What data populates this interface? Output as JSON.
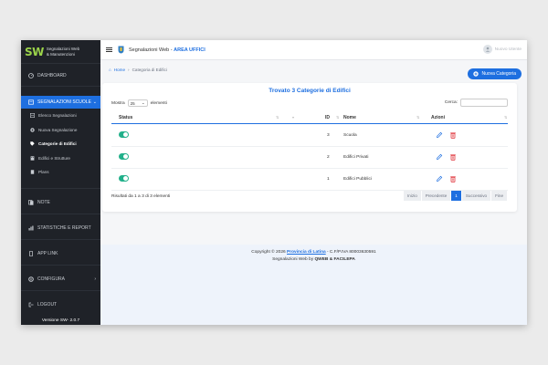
{
  "colors": {
    "accent": "#1e6fe0",
    "sidebar": "#1f2228",
    "toggle_on": "#21b08a",
    "delete": "#e0343b",
    "brand_green": "#9bd34a"
  },
  "sidebar": {
    "brand_short": "SW",
    "brand_line1": "Segnalazioni Web",
    "brand_line2": "& Manutenzioni",
    "dashboard": "DASHBOARD",
    "segnalazioni": "SEGNALAZIONI SCUOLE",
    "sub": {
      "elenco": "Elenco Segnalazioni",
      "nuova": "Nuova Segnalazione",
      "categorie": "Categorie di Edifici",
      "edifici": "Edifici e Strutture",
      "plans": "Plans"
    },
    "note": "NOTE",
    "statistiche": "STATISTICHE E REPORT",
    "app_link": "APP LINK",
    "configura": "CONFIGURA",
    "logout": "LOGOUT",
    "version": "Versione SW- 2.0.7"
  },
  "topbar": {
    "title_prefix": "Segnalazioni Web - ",
    "title_area": "AREA UFFICI",
    "user_name": "Nuovo Utente"
  },
  "breadcrumb": {
    "home": "Home",
    "current": "Categoria di Edifici"
  },
  "new_button": "Nuova Categoria",
  "card": {
    "title": "Trovato 3 Categorie di Edifici",
    "show_label": "Mostra",
    "show_value": "25",
    "show_suffix": "elementi",
    "search_label": "Cerca:",
    "columns": {
      "status": "Status",
      "id": "ID",
      "nome": "Nome",
      "azioni": "Azioni"
    },
    "rows": [
      {
        "status_on": true,
        "id": "3",
        "nome": "Scuola"
      },
      {
        "status_on": true,
        "id": "2",
        "nome": "Edifici Privati"
      },
      {
        "status_on": true,
        "id": "1",
        "nome": "Edifici Pubblici"
      }
    ],
    "info": "Risultati da 1 a 3 di 3 elementi",
    "pager": {
      "first": "Inizio",
      "prev": "Precedente",
      "current": "1",
      "next": "Successivo",
      "last": "Fine"
    }
  },
  "footer": {
    "line1_prefix": "Copyright © 2026 ",
    "line1_link": "Provincia di Latina",
    "line1_suffix": " - C.F/P.IVA 80003630591",
    "line2_prefix": "Segnalazioni Web by ",
    "line2_brand": "QWEB & FACILEPA"
  }
}
